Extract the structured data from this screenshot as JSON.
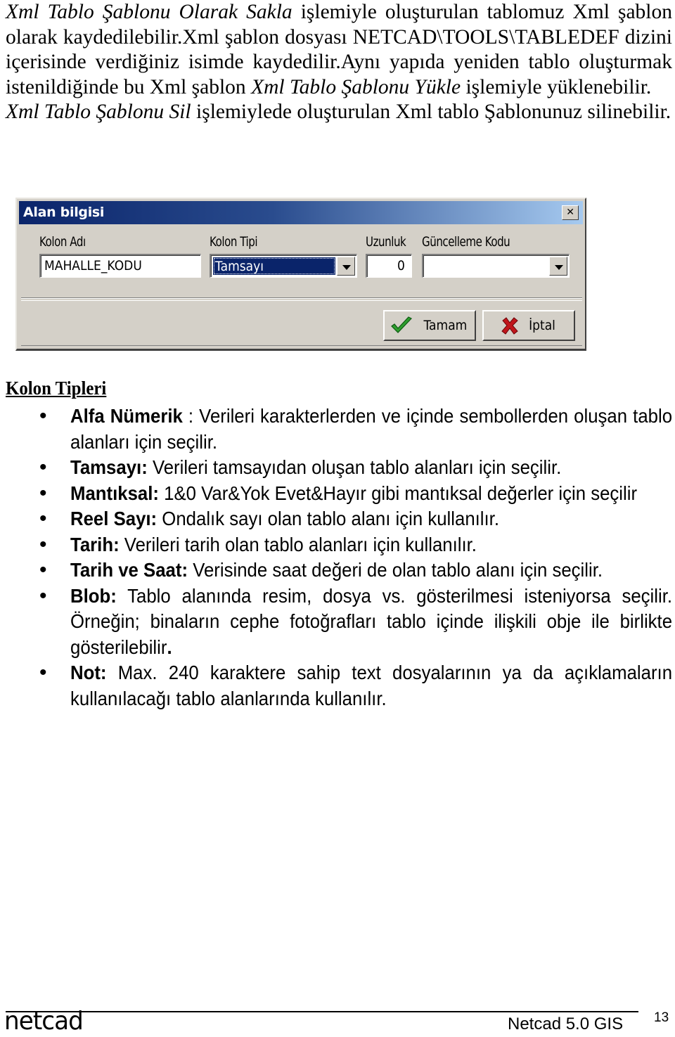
{
  "intro": {
    "p1": {
      "italic": "Xml Tablo Şablonu Olarak Sakla",
      "text": " işlemiyle oluşturulan tablomuz Xml şablon olarak kaydedilebilir.Xml şablon dosyası NETCAD\\TOOLS\\TABLEDEF dizini içerisinde verdiğiniz isimde kaydedilir.Aynı yapıda yeniden tablo oluşturmak istenildiğinde bu Xml şablon ",
      "italic2": "Xml Tablo Şablonu Yükle",
      "text2": " işlemiyle yüklenebilir."
    },
    "p2": {
      "italic": "Xml Tablo Şablonu Sil",
      "text": " işlemiylede oluşturulan Xml tablo Şablonunuz silinebilir."
    }
  },
  "dialog": {
    "title": "Alan bilgisi",
    "close_glyph": "✕",
    "labels": {
      "kolon_adi": "Kolon Adı",
      "kolon_tipi": "Kolon Tipi",
      "uzunluk": "Uzunluk",
      "guncelleme_kodu": "Güncelleme Kodu"
    },
    "values": {
      "kolon_adi": "MAHALLE_KODU",
      "kolon_tipi": "Tamsayı",
      "uzunluk": "0",
      "guncelleme_kodu": ""
    },
    "buttons": {
      "ok": "Tamam",
      "cancel": "İptal"
    },
    "colors": {
      "title_start": "#0a246a",
      "title_end": "#a6caf0",
      "face": "#d4d0c8",
      "check": "#2e9e2e",
      "cross": "#c0161c"
    }
  },
  "kolon_tipleri": {
    "title": "Kolon Tipleri",
    "items": [
      {
        "term": "Alfa Nümerik",
        "sep": " : ",
        "desc": "Verileri karakterlerden ve içinde sembollerden oluşan tablo alanları için seçilir."
      },
      {
        "term": "Tamsayı:",
        "sep": " ",
        "desc": "Verileri tamsayıdan oluşan tablo alanları için seçilir."
      },
      {
        "term": "Mantıksal:",
        "sep": " ",
        "desc": "1&0 Var&Yok Evet&Hayır gibi mantıksal değerler için seçilir"
      },
      {
        "term": "Reel Sayı:",
        "sep": " ",
        "desc": "Ondalık sayı olan tablo alanı için kullanılır."
      },
      {
        "term": "Tarih:",
        "sep": " ",
        "desc": "Verileri tarih olan tablo alanları için  kullanılır."
      },
      {
        "term": "Tarih ve Saat:",
        "sep": " ",
        "desc": "Verisinde  saat değeri de olan tablo alanı için seçilir."
      },
      {
        "term": "Blob:",
        "sep": " ",
        "desc": "Tablo alanında resim, dosya vs. gösterilmesi isteniyorsa seçilir. Örneğin; binaların cephe fotoğrafları tablo içinde ilişkili obje ile birlikte gösterilebilir",
        "tail_bold": "."
      },
      {
        "term": "Not:",
        "sep": " ",
        "desc": "Max. 240 karaktere sahip text dosyalarının ya da açıklamaların kullanılacağı tablo alanlarında kullanılır."
      }
    ]
  },
  "footer": {
    "logo": "netcad",
    "product": "Netcad 5.0 GIS",
    "page": "13"
  }
}
